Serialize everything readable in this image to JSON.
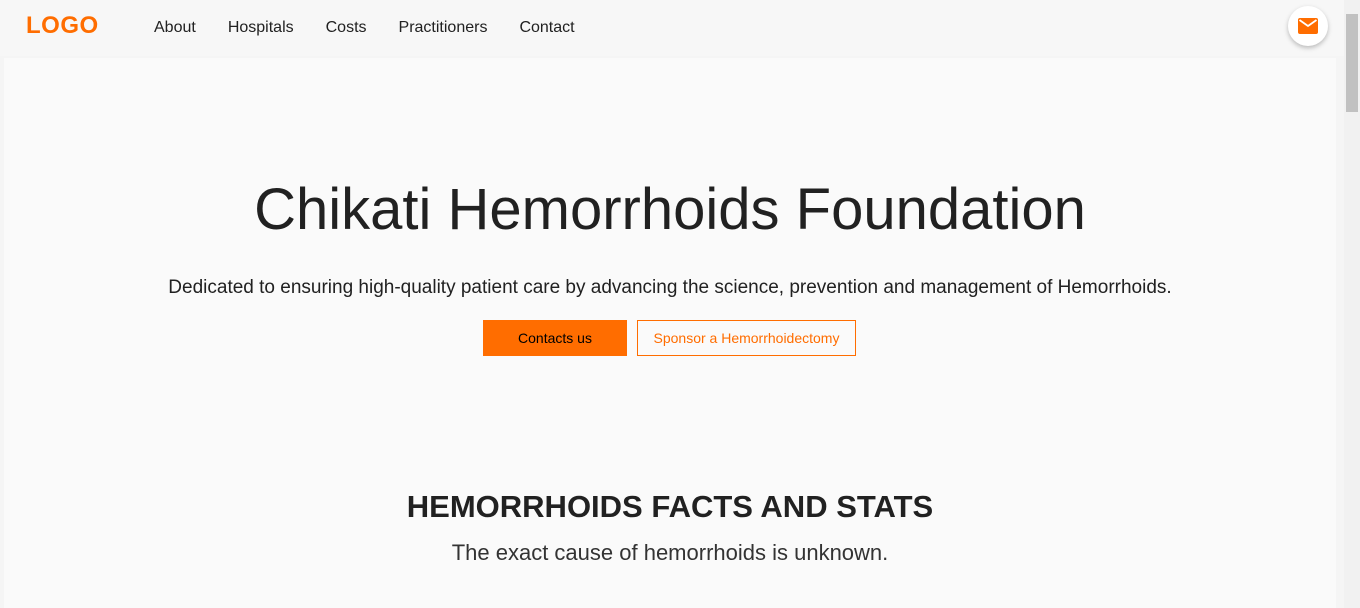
{
  "header": {
    "logo": "LOGO",
    "nav": [
      "About",
      "Hospitals",
      "Costs",
      "Practitioners",
      "Contact"
    ]
  },
  "hero": {
    "title": "Chikati Hemorrhoids Foundation",
    "subtitle": "Dedicated to ensuring high-quality patient care by advancing the science, prevention and management of Hemorrhoids.",
    "primary_button": "Contacts us",
    "secondary_button": "Sponsor a Hemorrhoidectomy"
  },
  "facts": {
    "title": "HEMORRHOIDS FACTS AND STATS",
    "subtitle": "The exact cause of hemorrhoids is unknown."
  },
  "icons": {
    "mail": "mail-icon"
  },
  "colors": {
    "accent": "#ff6d00",
    "background": "#fafafa",
    "text": "#212121"
  }
}
